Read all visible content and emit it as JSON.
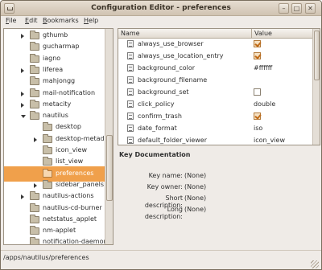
{
  "window": {
    "title": "Configuration Editor - preferences"
  },
  "menubar": {
    "file": "File",
    "edit": "Edit",
    "bookmarks": "Bookmarks",
    "help": "Help"
  },
  "tree": {
    "items": [
      {
        "label": "gthumb",
        "expander": "collapsed",
        "selected": false
      },
      {
        "label": "gucharmap",
        "expander": "none",
        "selected": false
      },
      {
        "label": "iagno",
        "expander": "none",
        "selected": false
      },
      {
        "label": "liferea",
        "expander": "collapsed",
        "selected": false
      },
      {
        "label": "mahjongg",
        "expander": "none",
        "selected": false
      },
      {
        "label": "mail-notification",
        "expander": "collapsed",
        "selected": false
      },
      {
        "label": "metacity",
        "expander": "collapsed",
        "selected": false
      },
      {
        "label": "nautilus",
        "expander": "expanded",
        "selected": false
      },
      {
        "label": "desktop",
        "expander": "none",
        "selected": false
      },
      {
        "label": "desktop-metadata",
        "expander": "collapsed",
        "selected": false
      },
      {
        "label": "icon_view",
        "expander": "none",
        "selected": false
      },
      {
        "label": "list_view",
        "expander": "none",
        "selected": false
      },
      {
        "label": "preferences",
        "expander": "none",
        "selected": true
      },
      {
        "label": "sidebar_panels",
        "expander": "collapsed",
        "selected": false
      },
      {
        "label": "nautilus-actions",
        "expander": "collapsed",
        "selected": false
      },
      {
        "label": "nautilus-cd-burner",
        "expander": "none",
        "selected": false
      },
      {
        "label": "netstatus_applet",
        "expander": "none",
        "selected": false
      },
      {
        "label": "nm-applet",
        "expander": "none",
        "selected": false
      },
      {
        "label": "notification-daemon",
        "expander": "none",
        "selected": false
      }
    ]
  },
  "keys": {
    "header_name": "Name",
    "header_value": "Value",
    "rows": [
      {
        "name": "always_use_browser",
        "kind": "bool",
        "value": true
      },
      {
        "name": "always_use_location_entry",
        "kind": "bool",
        "value": true
      },
      {
        "name": "background_color",
        "kind": "text",
        "value": "#ffffff"
      },
      {
        "name": "background_filename",
        "kind": "text",
        "value": ""
      },
      {
        "name": "background_set",
        "kind": "bool",
        "value": false
      },
      {
        "name": "click_policy",
        "kind": "text",
        "value": "double"
      },
      {
        "name": "confirm_trash",
        "kind": "bool",
        "value": true
      },
      {
        "name": "date_format",
        "kind": "text",
        "value": "iso"
      },
      {
        "name": "default_folder_viewer",
        "kind": "text",
        "value": "icon_view"
      }
    ]
  },
  "documentation": {
    "title": "Key Documentation",
    "key_name_label": "Key name:",
    "key_name_value": "(None)",
    "key_owner_label": "Key owner:",
    "key_owner_value": "(None)",
    "short_desc_label": "Short description:",
    "short_desc_value": "(None)",
    "long_desc_label": "Long description:",
    "long_desc_value": "(None)"
  },
  "statusbar": {
    "path": "/apps/nautilus/preferences"
  },
  "colors": {
    "selection": "#f0a04b",
    "checkbox_accent": "#c06a17"
  }
}
